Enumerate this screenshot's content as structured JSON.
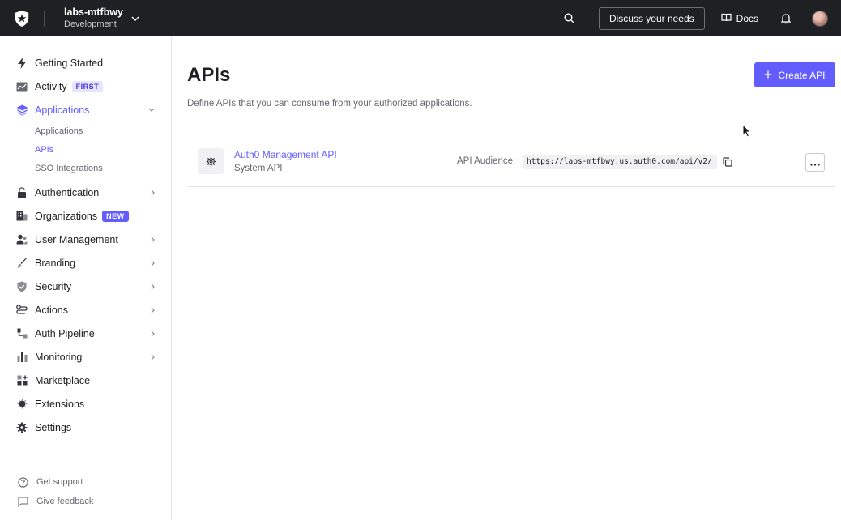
{
  "topbar": {
    "tenant_name": "labs-mtfbwy",
    "tenant_env": "Development",
    "discuss_label": "Discuss your needs",
    "docs_label": "Docs",
    "background": "#1f2023"
  },
  "sidebar": {
    "items": [
      {
        "label": "Getting Started",
        "icon": "bolt-icon"
      },
      {
        "label": "Activity",
        "icon": "activity-icon",
        "badge": "FIRST"
      },
      {
        "label": "Applications",
        "icon": "layers-icon",
        "expanded": true,
        "active": true
      },
      {
        "label": "Authentication",
        "icon": "lock-icon"
      },
      {
        "label": "Organizations",
        "icon": "building-icon",
        "badge": "NEW"
      },
      {
        "label": "User Management",
        "icon": "users-icon"
      },
      {
        "label": "Branding",
        "icon": "brush-icon"
      },
      {
        "label": "Security",
        "icon": "shield-icon"
      },
      {
        "label": "Actions",
        "icon": "actions-icon"
      },
      {
        "label": "Auth Pipeline",
        "icon": "pipeline-icon"
      },
      {
        "label": "Monitoring",
        "icon": "bar-chart-icon"
      },
      {
        "label": "Marketplace",
        "icon": "grid-plus-icon"
      },
      {
        "label": "Extensions",
        "icon": "extension-icon"
      },
      {
        "label": "Settings",
        "icon": "gear-icon"
      }
    ],
    "sub_items": [
      {
        "label": "Applications"
      },
      {
        "label": "APIs",
        "active": true
      },
      {
        "label": "SSO Integrations"
      }
    ],
    "footer": [
      {
        "label": "Get support",
        "icon": "help-circle-icon"
      },
      {
        "label": "Give feedback",
        "icon": "message-icon"
      }
    ]
  },
  "main": {
    "title": "APIs",
    "description": "Define APIs that you can consume from your authorized applications.",
    "create_label": "Create API",
    "apis": [
      {
        "name": "Auth0 Management API",
        "type": "System API",
        "audience_label": "API Audience:",
        "audience": "https://labs-mtfbwy.us.auth0.com/api/v2/"
      }
    ]
  },
  "colors": {
    "accent": "#635dff",
    "text": "#1e1f21",
    "muted": "#65676e"
  }
}
